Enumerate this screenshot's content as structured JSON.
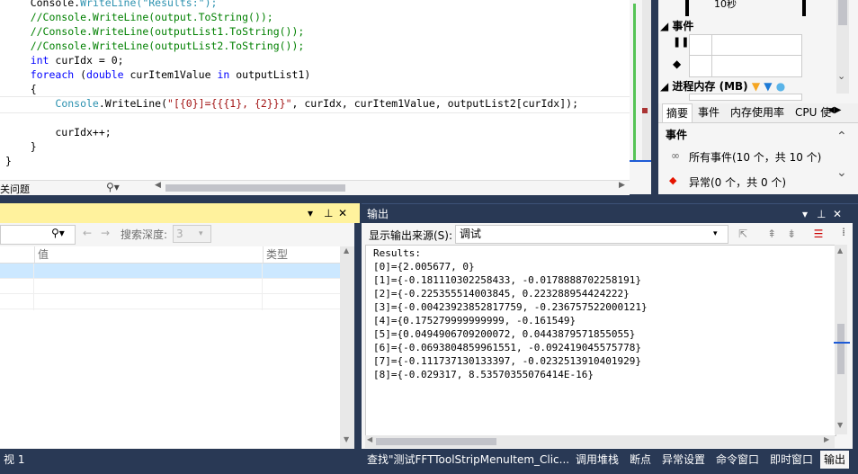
{
  "editor": {
    "code_lines": [
      {
        "parts": [
          {
            "t": "    Console.",
            "c": "plain"
          },
          {
            "t": "WriteLine(\"Results:\");",
            "c": "str-mix"
          }
        ],
        "raw": "    Console.WriteLine(\"Results:\");"
      },
      {
        "parts": [
          {
            "t": "    //Console.WriteLine(output.ToString());",
            "c": "cm"
          }
        ]
      },
      {
        "parts": [
          {
            "t": "    //Console.WriteLine(outputList1.ToString());",
            "c": "cm"
          }
        ]
      },
      {
        "parts": [
          {
            "t": "    //Console.WriteLine(outputList2.ToString());",
            "c": "cm"
          }
        ]
      },
      {
        "parts": [
          {
            "t": "    ",
            "c": "plain"
          },
          {
            "t": "int",
            "c": "kw"
          },
          {
            "t": " curIdx = 0;",
            "c": "plain"
          }
        ]
      },
      {
        "parts": [
          {
            "t": "    ",
            "c": "plain"
          },
          {
            "t": "foreach",
            "c": "kw"
          },
          {
            "t": " (",
            "c": "plain"
          },
          {
            "t": "double",
            "c": "kw"
          },
          {
            "t": " curItem1Value ",
            "c": "plain"
          },
          {
            "t": "in",
            "c": "kw"
          },
          {
            "t": " outputList1)",
            "c": "plain"
          }
        ]
      },
      {
        "parts": [
          {
            "t": "    {",
            "c": "plain"
          }
        ]
      },
      {
        "parts": [
          {
            "t": "        ",
            "c": "plain"
          },
          {
            "t": "Console",
            "c": "tp"
          },
          {
            "t": ".WriteLine(",
            "c": "plain"
          },
          {
            "t": "\"[{0}]={{{1}, {2}}}\"",
            "c": "str"
          },
          {
            "t": ", curIdx, curItem1Value, outputList2[curIdx]);",
            "c": "plain"
          }
        ]
      },
      {
        "parts": [
          {
            "t": "",
            "c": "plain"
          }
        ]
      },
      {
        "parts": [
          {
            "t": "        curIdx++;",
            "c": "plain"
          }
        ]
      },
      {
        "parts": [
          {
            "t": "    }",
            "c": "plain"
          }
        ]
      },
      {
        "parts": [
          {
            "t": "}",
            "c": "plain"
          }
        ]
      }
    ],
    "status_left": "关问题"
  },
  "diag": {
    "timeline_label": "10秒",
    "events_header": "事件",
    "memory_header": "进程内存 (MB)",
    "tabs": [
      "摘要",
      "事件",
      "内存使用率",
      "CPU 使"
    ],
    "events_section": "事件",
    "all_events": "所有事件(10 个，共 10 个)",
    "exceptions": "异常(0 个，共 0 个)"
  },
  "locals": {
    "search_label": "搜索深度:",
    "search_depth": "3",
    "col_value": "值",
    "col_type": "类型"
  },
  "output": {
    "title": "输出",
    "source_label": "显示输出来源(S):",
    "source_value": "调试",
    "lines": [
      "Results:",
      "[0]={2.005677, 0}",
      "[1]={-0.181110302258433, -0.0178888702258191}",
      "[2]={-0.225355514003845, 0.223288954424222}",
      "[3]={-0.00423923852817759, -0.236757522000121}",
      "[4]={0.175279999999999, -0.161549}",
      "[5]={0.0494906709200072, 0.0443879571855055}",
      "[6]={-0.0693804859961551, -0.092419045575778}",
      "[7]={-0.111737130133397, -0.0232513910401929}",
      "[8]={-0.029317, 8.53570355076414E-16}"
    ]
  },
  "bottom_tabs": {
    "left_tab": "视 1",
    "tabs": [
      "查找\"测试FFTToolStripMenuItem_Clic...",
      "调用堆栈",
      "断点",
      "异常设置",
      "命令窗口",
      "即时窗口",
      "输出"
    ]
  },
  "colors": {
    "chrome": "#293955",
    "active_title": "#fff29d",
    "selection": "#cce8ff"
  }
}
